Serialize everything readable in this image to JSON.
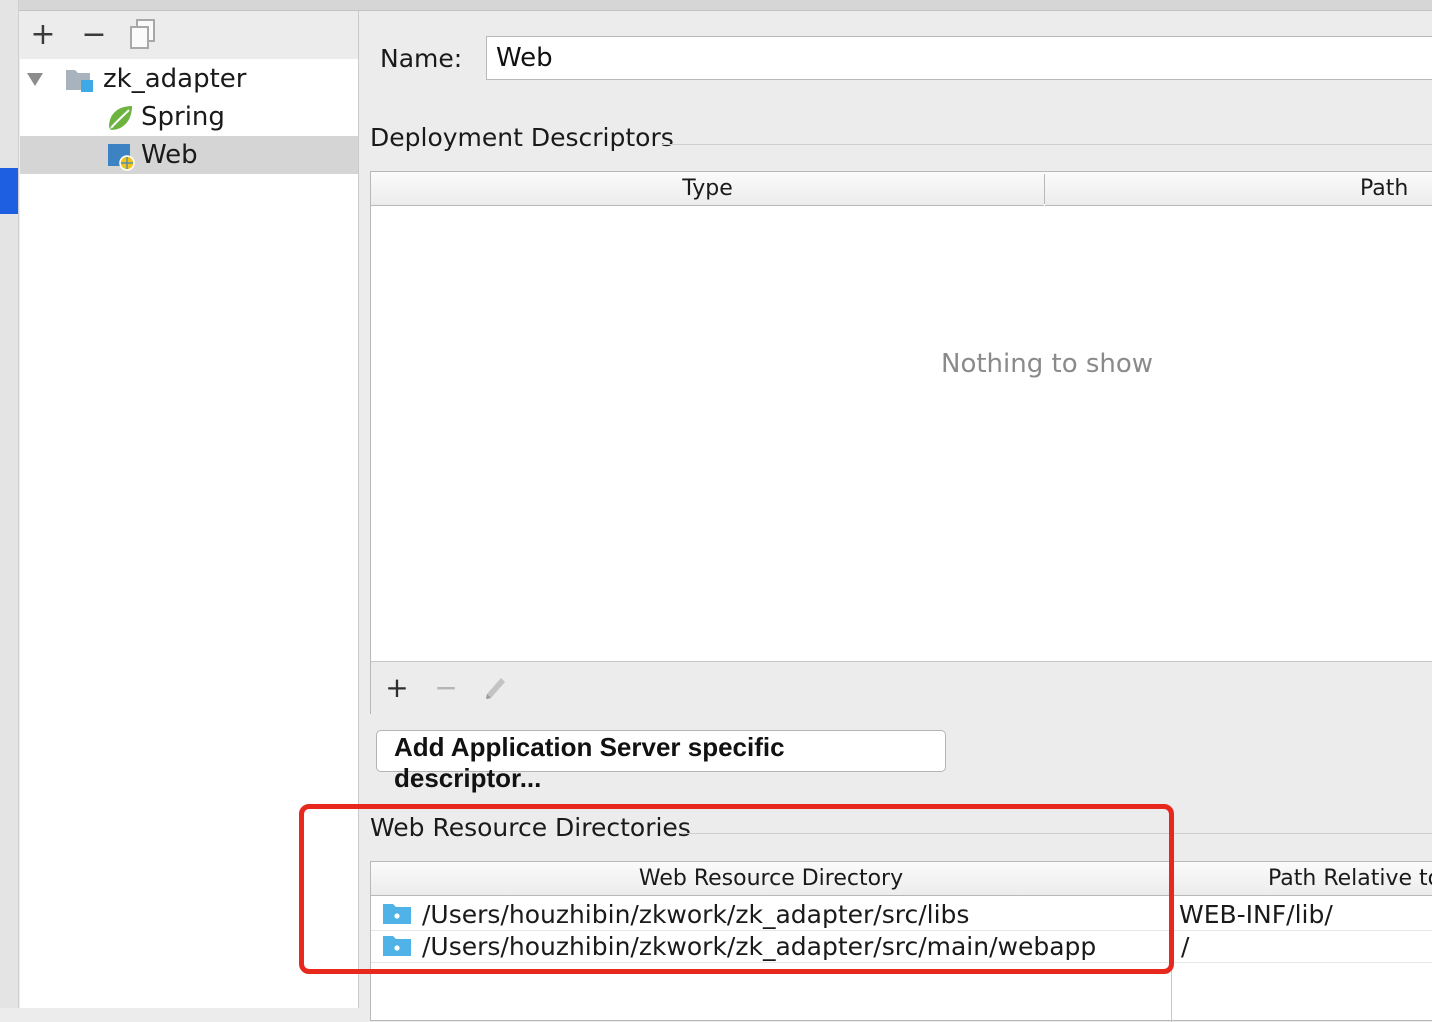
{
  "tree": {
    "toolbar": {
      "add": "+",
      "remove": "−"
    },
    "items": [
      {
        "label": "zk_adapter",
        "icon": "module-folder-icon",
        "expanded": true
      },
      {
        "label": "Spring",
        "icon": "spring-leaf-icon"
      },
      {
        "label": "Web",
        "icon": "web-facet-icon",
        "selected": true
      }
    ]
  },
  "form": {
    "name_label": "Name:",
    "name_value": "Web"
  },
  "deployment": {
    "title": "Deployment Descriptors",
    "columns": [
      "Type",
      "Path"
    ],
    "empty_text": "Nothing to show",
    "toolbar": {
      "add": "+",
      "remove": "−"
    },
    "add_server_button": "Add Application Server specific descriptor..."
  },
  "web_resources": {
    "title": "Web Resource Directories",
    "columns": [
      "Web Resource Directory",
      "Path Relative to"
    ],
    "rows": [
      {
        "directory": "/Users/houzhibin/zkwork/zk_adapter/src/libs",
        "relative": "WEB-INF/lib/"
      },
      {
        "directory": "/Users/houzhibin/zkwork/zk_adapter/src/main/webapp",
        "relative": "/"
      }
    ]
  },
  "colors": {
    "highlight": "#e8281d",
    "accent": "#1d5fe0",
    "spring": "#6db33f",
    "folder": "#4fb3e8"
  }
}
